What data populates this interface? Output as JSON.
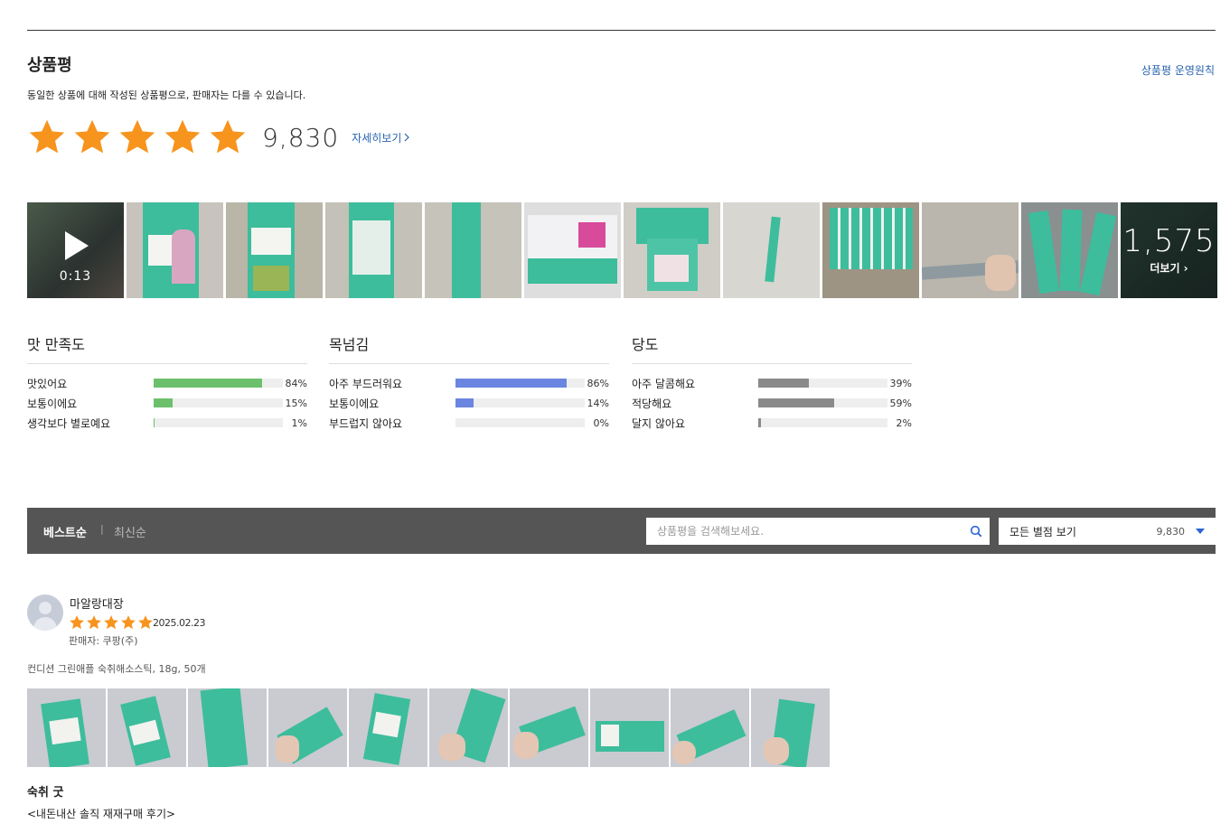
{
  "header": {
    "title": "상품평",
    "policy_link": "상품평 운영원칙",
    "notice": "동일한 상품에 대해 작성된 상품평으로, 판매자는 다를 수 있습니다."
  },
  "rating": {
    "stars": 5,
    "count": "9,830",
    "detail_link": "자세히보기"
  },
  "photos": {
    "video_duration": "0:13",
    "more_count": "1,575",
    "more_label": "더보기"
  },
  "surveys": [
    {
      "title": "맛 만족도",
      "color": "#6cc06c",
      "rows": [
        {
          "label": "맛있어요",
          "pct": "84%",
          "value": 84
        },
        {
          "label": "보통이에요",
          "pct": "15%",
          "value": 15
        },
        {
          "label": "생각보다 별로예요",
          "pct": "1%",
          "value": 1
        }
      ]
    },
    {
      "title": "목넘김",
      "color": "#6b86e0",
      "rows": [
        {
          "label": "아주 부드러워요",
          "pct": "86%",
          "value": 86
        },
        {
          "label": "보통이에요",
          "pct": "14%",
          "value": 14
        },
        {
          "label": "부드럽지 않아요",
          "pct": "0%",
          "value": 0
        }
      ]
    },
    {
      "title": "당도",
      "color": "#8a8a8a",
      "rows": [
        {
          "label": "아주 달콤해요",
          "pct": "39%",
          "value": 39
        },
        {
          "label": "적당해요",
          "pct": "59%",
          "value": 59
        },
        {
          "label": "달지 않아요",
          "pct": "2%",
          "value": 2
        }
      ]
    }
  ],
  "toolbar": {
    "sort_best": "베스트순",
    "sort_separator": "|",
    "sort_new": "최신순",
    "search_placeholder": "상품평을 검색해보세요.",
    "filter_label": "모든 별점 보기",
    "filter_count": "9,830"
  },
  "review": {
    "reviewer": "마알랑대장",
    "stars": 5,
    "date": "2025.02.23",
    "seller": "판매자: 쿠팡(주)",
    "option": "컨디션 그린애플 숙취해소스틱, 18g, 50개",
    "photo_count": 10,
    "headline": "숙취 굿",
    "body": "<내돈내산 솔직 재재구매 후기>"
  },
  "colors": {
    "star": "#f7941d",
    "link": "#2a64b0",
    "toolbar_bg": "#555555",
    "product_teal": "#36b99a"
  }
}
